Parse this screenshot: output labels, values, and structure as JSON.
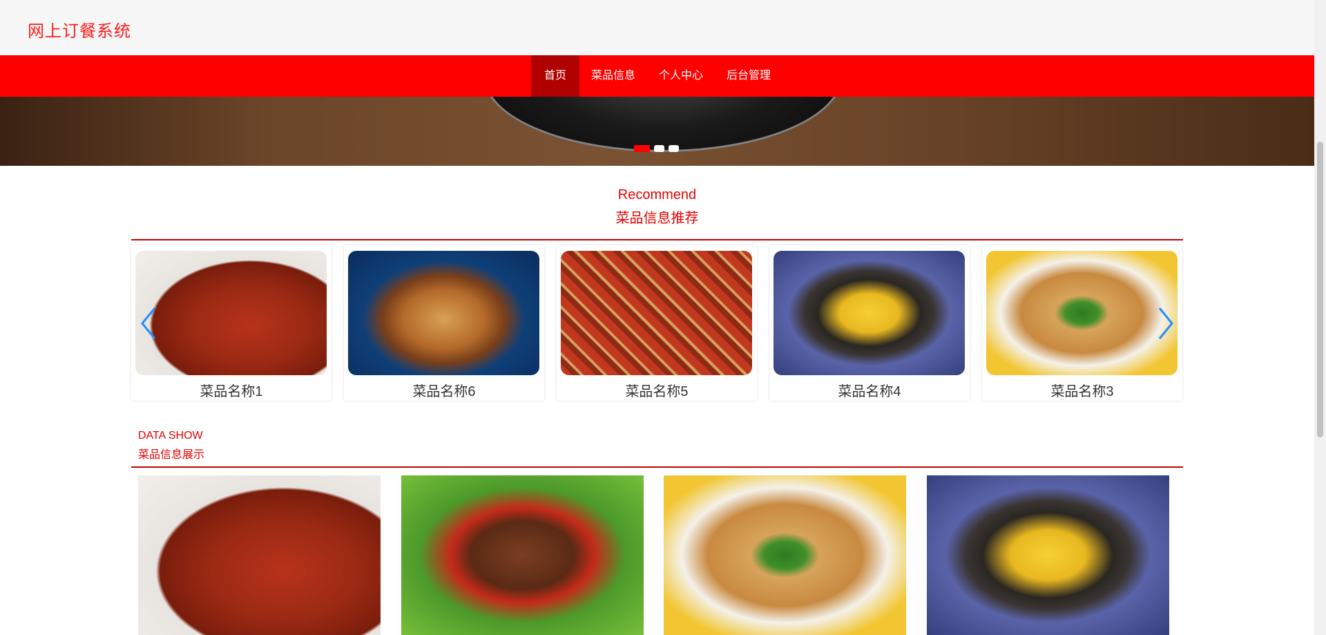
{
  "header": {
    "site_title": "网上订餐系统"
  },
  "nav": {
    "items": [
      {
        "label": "首页",
        "active": true
      },
      {
        "label": "菜品信息",
        "active": false
      },
      {
        "label": "个人中心",
        "active": false
      },
      {
        "label": "后台管理",
        "active": false
      }
    ]
  },
  "banner": {
    "slide_count": 3,
    "active_slide": 1
  },
  "recommend": {
    "title_en": "Recommend",
    "title_cn": "菜品信息推荐",
    "items": [
      {
        "name": "菜品名称1",
        "image": "spicy-tripe-image"
      },
      {
        "name": "菜品名称6",
        "image": "burger-image"
      },
      {
        "name": "菜品名称5",
        "image": "hotpot-image"
      },
      {
        "name": "菜品名称4",
        "image": "mango-dessert-image"
      },
      {
        "name": "菜品名称3",
        "image": "fried-tofu-broccoli-image"
      }
    ]
  },
  "showcase": {
    "title_en": "DATA SHOW",
    "title_cn": "菜品信息展示",
    "items": [
      {
        "image": "spicy-tripe-image"
      },
      {
        "image": "grilled-kebab-image"
      },
      {
        "image": "fried-tofu-broccoli-image"
      },
      {
        "image": "mango-dessert-image"
      }
    ]
  },
  "colors": {
    "brand": "#ff0000",
    "nav_active": "#b00000",
    "text_accent": "#e60000"
  }
}
